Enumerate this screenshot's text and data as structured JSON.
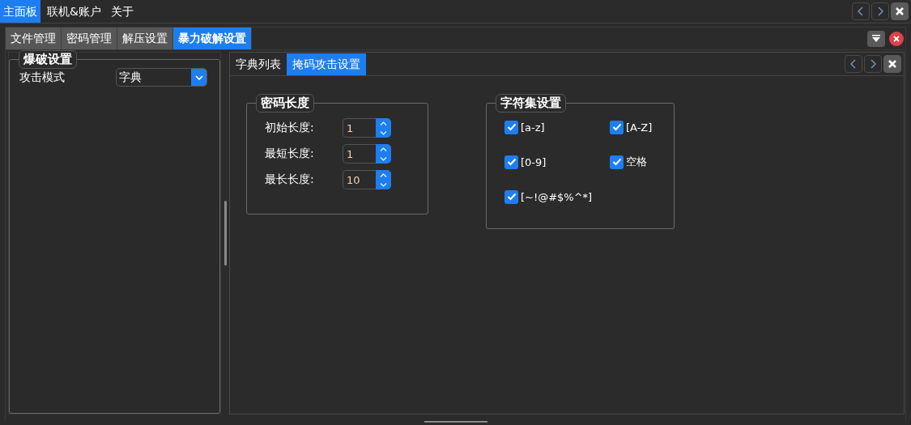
{
  "menu": [
    {
      "label": "主面板",
      "selected": true
    },
    {
      "label": "联机&账户",
      "selected": false
    },
    {
      "label": "关于",
      "selected": false
    }
  ],
  "tabs": [
    {
      "label": "文件管理",
      "selected": false
    },
    {
      "label": "密码管理",
      "selected": false
    },
    {
      "label": "解压设置",
      "selected": false
    },
    {
      "label": "暴力破解设置",
      "selected": true
    }
  ],
  "left_panel": {
    "group_title": "爆破设置",
    "attack_mode": {
      "label": "攻击模式",
      "value": "字典"
    }
  },
  "sub_tabs": [
    {
      "label": "字典列表",
      "selected": false
    },
    {
      "label": "掩码攻击设置",
      "selected": true
    }
  ],
  "length_group": {
    "title": "密码长度",
    "fields": [
      {
        "label": "初始长度:",
        "value": "1"
      },
      {
        "label": "最短长度:",
        "value": "1"
      },
      {
        "label": "最长长度:",
        "value": "10"
      }
    ]
  },
  "charset_group": {
    "title": "字符集设置",
    "options": [
      {
        "label": "[a-z]",
        "checked": true
      },
      {
        "label": "[A-Z]",
        "checked": true
      },
      {
        "label": "[0-9]",
        "checked": true
      },
      {
        "label": "空格",
        "checked": true
      },
      {
        "label": "[~!@#$%^*]",
        "checked": true
      }
    ]
  }
}
